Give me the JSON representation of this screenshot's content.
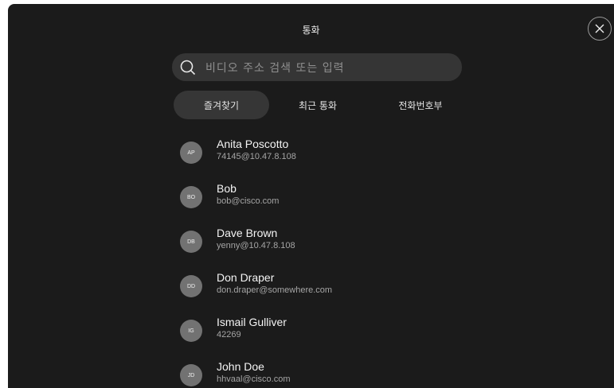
{
  "header": {
    "title": "통화"
  },
  "search": {
    "placeholder": "비디오 주소 검색 또는 입력"
  },
  "tabs": [
    {
      "label": "즐겨찾기",
      "active": true
    },
    {
      "label": "최근 통화",
      "active": false
    },
    {
      "label": "전화번호부",
      "active": false
    }
  ],
  "contacts": [
    {
      "initials": "AP",
      "name": "Anita Poscotto",
      "address": "74145@10.47.8.108"
    },
    {
      "initials": "BO",
      "name": "Bob",
      "address": "bob@cisco.com"
    },
    {
      "initials": "DB",
      "name": "Dave Brown",
      "address": "yenny@10.47.8.108"
    },
    {
      "initials": "DD",
      "name": "Don Draper",
      "address": "don.draper@somewhere.com"
    },
    {
      "initials": "IG",
      "name": "Ismail Gulliver",
      "address": "42269"
    },
    {
      "initials": "JD",
      "name": "John Doe",
      "address": "hhvaal@cisco.com"
    }
  ],
  "icons": {
    "close": "close-icon",
    "search": "search-icon"
  },
  "colors": {
    "background": "#1b1b1b",
    "surface": "#363636",
    "avatar": "#727272",
    "text": "#f4f4f4",
    "subtext": "#a5a5a5"
  }
}
